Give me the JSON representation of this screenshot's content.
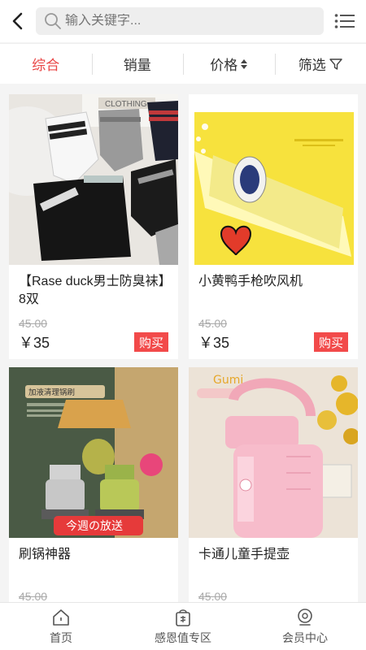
{
  "header": {
    "back_icon": "chevron-left-icon",
    "search_placeholder": "输入关键字...",
    "menu_icon": "list-menu-icon"
  },
  "sort": {
    "tabs": [
      {
        "label": "综合",
        "active": true
      },
      {
        "label": "销量",
        "active": false
      },
      {
        "label": "价格",
        "active": false,
        "icon": "sort-updown-icon"
      },
      {
        "label": "筛选",
        "active": false,
        "icon": "filter-icon"
      }
    ]
  },
  "products": [
    {
      "name": "【Rase duck男士防臭袜】8双",
      "original_price": "45.00",
      "price": "￥35",
      "buy_label": "购买",
      "image_caption": ""
    },
    {
      "name": "小黄鸭手枪吹风机",
      "original_price": "45.00",
      "price": "￥35",
      "buy_label": "购买",
      "image_caption": ""
    },
    {
      "name": "刷锅神器",
      "original_price": "45.00",
      "price": "",
      "buy_label": "",
      "image_caption": "今週の放送",
      "image_banner": "加液清理锅刷"
    },
    {
      "name": "卡通儿童手提壶",
      "original_price": "45.00",
      "price": "",
      "buy_label": "",
      "image_caption": "",
      "image_tag": "Gumi"
    }
  ],
  "bottom_nav": [
    {
      "label": "首页",
      "icon": "home-icon"
    },
    {
      "label": "感恩值专区",
      "icon": "gift-bag-icon"
    },
    {
      "label": "会员中心",
      "icon": "member-icon"
    }
  ],
  "colors": {
    "accent": "#e94545",
    "buy_button": "#f24a4a",
    "background": "#f4f4f4"
  }
}
